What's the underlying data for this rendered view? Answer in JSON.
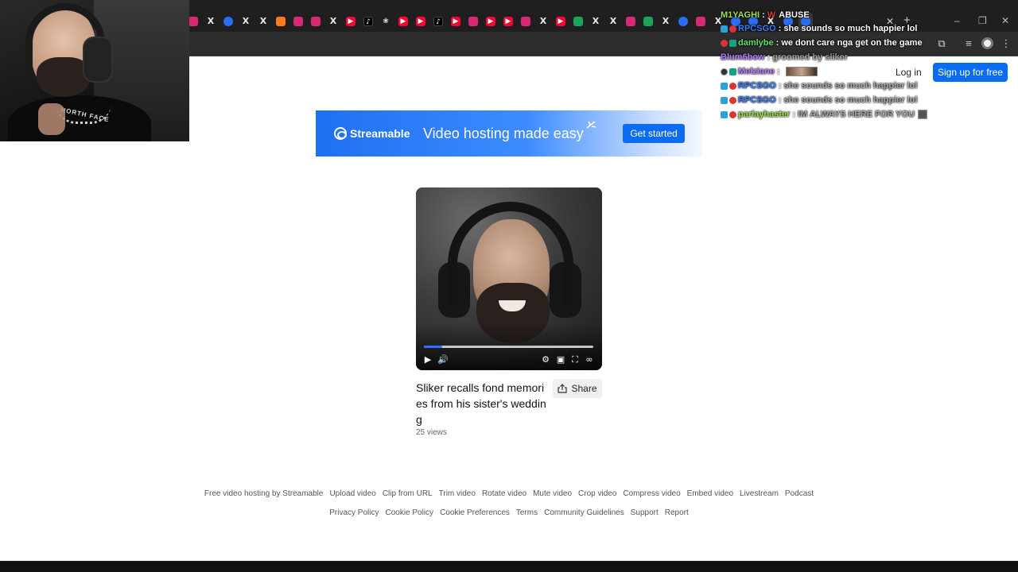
{
  "browser": {
    "tabs": [
      {
        "icon": "instagram-icon",
        "glyph": ""
      },
      {
        "icon": "x-icon",
        "glyph": "X"
      },
      {
        "icon": "streamable-icon",
        "glyph": ""
      },
      {
        "icon": "x-icon",
        "glyph": "X"
      },
      {
        "icon": "x-icon",
        "glyph": "X"
      },
      {
        "icon": "orange-icon",
        "glyph": ""
      },
      {
        "icon": "instagram-icon",
        "glyph": ""
      },
      {
        "icon": "instagram-icon",
        "glyph": ""
      },
      {
        "icon": "x-icon",
        "glyph": "X"
      },
      {
        "icon": "youtube-icon",
        "glyph": "▶"
      },
      {
        "icon": "tiktok-icon",
        "glyph": "♪"
      },
      {
        "icon": "openai-icon",
        "glyph": "❀"
      },
      {
        "icon": "youtube-icon",
        "glyph": "▶"
      },
      {
        "icon": "youtube-icon",
        "glyph": "▶"
      },
      {
        "icon": "tiktok-icon",
        "glyph": "♪"
      },
      {
        "icon": "youtube-icon",
        "glyph": "▶"
      },
      {
        "icon": "feather-icon",
        "glyph": ""
      },
      {
        "icon": "youtube-icon",
        "glyph": "▶"
      },
      {
        "icon": "youtube-icon",
        "glyph": "▶"
      },
      {
        "icon": "instagram-icon",
        "glyph": ""
      },
      {
        "icon": "x-icon",
        "glyph": "X"
      },
      {
        "icon": "youtube-icon",
        "glyph": "▶"
      },
      {
        "icon": "green-icon",
        "glyph": ""
      },
      {
        "icon": "x-icon",
        "glyph": "X"
      },
      {
        "icon": "x-icon",
        "glyph": "X"
      },
      {
        "icon": "instagram-icon",
        "glyph": ""
      },
      {
        "icon": "green-icon",
        "glyph": ""
      },
      {
        "icon": "x-icon",
        "glyph": "X"
      },
      {
        "icon": "streamable-icon",
        "glyph": ""
      },
      {
        "icon": "instagram-icon",
        "glyph": ""
      },
      {
        "icon": "x-icon",
        "glyph": "X"
      },
      {
        "icon": "streamable-icon",
        "glyph": ""
      },
      {
        "icon": "streamable-icon",
        "glyph": ""
      },
      {
        "icon": "x-icon",
        "glyph": "X"
      },
      {
        "icon": "streamable-icon",
        "glyph": ""
      },
      {
        "icon": "streamable-icon",
        "glyph": ""
      }
    ],
    "new_tab_glyph": "+",
    "close_tab_glyph": "✕"
  },
  "chat": [
    {
      "user": "M1YAGHI",
      "user_color": "#9be24a",
      "message": "ABUSE",
      "faint": false,
      "badges": [],
      "extra": "W"
    },
    {
      "user": "RPCSGO",
      "user_color": "#3d7bff",
      "message": "she sounds so much happier lol",
      "faint": false,
      "badges": [
        "blue",
        "red"
      ]
    },
    {
      "user": "damlybe",
      "user_color": "#5fe36a",
      "message": "we dont care nga get on the game",
      "faint": false,
      "badges": [
        "red",
        "green"
      ]
    },
    {
      "user": "Blum6bow",
      "user_color": "#b07cff",
      "message": "groomed by sliker",
      "faint": true,
      "badges": []
    },
    {
      "user": "Melziane",
      "user_color": "#c27bff",
      "message": "",
      "faint": false,
      "badges": [
        "dark",
        "green"
      ],
      "emote": true
    },
    {
      "user": "RPCSGO",
      "user_color": "#3d7bff",
      "message": "she sounds so much happier lol",
      "faint": true,
      "badges": [
        "blue",
        "red"
      ]
    },
    {
      "user": "RPCSGO",
      "user_color": "#3d7bff",
      "message": "she sounds so much happier lol",
      "faint": true,
      "badges": [
        "blue",
        "red"
      ]
    },
    {
      "user": "parlayhaster",
      "user_color": "#9be24a",
      "message": "IM ALWAYS HERE FOR YOU",
      "faint": true,
      "badges": [
        "blue",
        "red"
      ],
      "emote_small": true
    }
  ],
  "header": {
    "login": "Log in",
    "signup": "Sign up for free"
  },
  "banner": {
    "brand": "Streamable",
    "tagline": "Video hosting made easy",
    "cta": "Get started"
  },
  "video": {
    "title": "Sliker recalls fond memories from his sister's wedding",
    "views": "25 views",
    "share": "Share",
    "progress_fraction": 0.11,
    "controls": {
      "play": "▶",
      "volume": "🔊",
      "settings": "⚙",
      "pip": "▣",
      "fullscreen": "⛶",
      "brand": "∞"
    }
  },
  "footer": {
    "row1": [
      "Free video hosting by Streamable",
      "Upload video",
      "Clip from URL",
      "Trim video",
      "Rotate video",
      "Mute video",
      "Crop video",
      "Compress video",
      "Embed video",
      "Livestream",
      "Podcast"
    ],
    "row2": [
      "Privacy Policy",
      "Cookie Policy",
      "Cookie Preferences",
      "Terms",
      "Community Guidelines",
      "Support",
      "Report"
    ]
  },
  "webcam": {
    "shirt_text": "NORTH FACE"
  },
  "colors": {
    "accent": "#0a6cf0",
    "progress": "#2b72ff",
    "chrome_dark": "#1f1f1f"
  }
}
